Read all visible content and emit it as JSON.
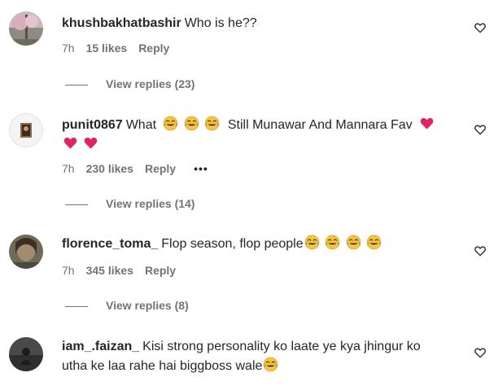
{
  "comments": [
    {
      "username": "khushbakhatbashir",
      "text": "Who is he??",
      "time": "7h",
      "likes": "15 likes",
      "reply": "Reply",
      "view_replies": "View replies (23)"
    },
    {
      "username": "punit0867",
      "text_1": "What",
      "text_2": "Still Munawar And Mannara Fav",
      "time": "7h",
      "likes": "230 likes",
      "reply": "Reply",
      "more": "•••",
      "view_replies": "View replies (14)"
    },
    {
      "username": "florence_toma_",
      "text": "Flop season, flop people",
      "time": "7h",
      "likes": "345 likes",
      "reply": "Reply",
      "view_replies": "View replies (8)"
    },
    {
      "username": "iam_.faizan_",
      "text_1": "Kisi strong personality ko laate ye kya jhingur ko",
      "text_2": "utha ke laa rahe hai biggboss wale"
    }
  ],
  "icons": {
    "like": "heart-outline-icon",
    "laugh": "face-with-tears-of-joy-emoji",
    "love": "red-heart-emoji",
    "more": "more-options-icon"
  },
  "colors": {
    "text": "#262626",
    "secondary": "#737373",
    "heart": "#e0245e",
    "emoji": "#f6c33b"
  }
}
